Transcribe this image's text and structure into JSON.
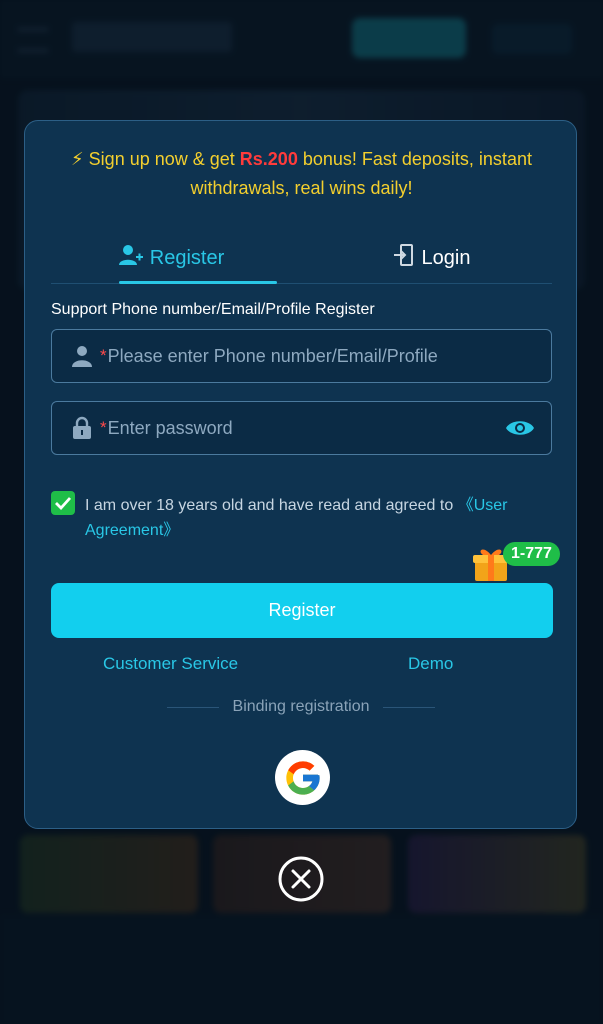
{
  "promo": {
    "bolt": "⚡",
    "prefix": " Sign up now & get ",
    "amount": "Rs.200",
    "suffix": " bonus! Fast deposits, instant withdrawals, real wins daily!"
  },
  "tabs": {
    "register": "Register",
    "login": "Login"
  },
  "support_label": "Support Phone number/Email/Profile Register",
  "fields": {
    "account": {
      "required_mark": "*",
      "placeholder": "Please enter Phone number/Email/Profile",
      "value": ""
    },
    "password": {
      "required_mark": "*",
      "placeholder": "Enter password",
      "value": ""
    }
  },
  "agreement": {
    "checked": true,
    "text": "I am over 18 years old and have read and agreed to ",
    "link": "《User Agreement》"
  },
  "gift_badge": "1-777",
  "register_button": "Register",
  "links": {
    "customer_service": "Customer Service",
    "demo": "Demo"
  },
  "binding_label": "Binding registration",
  "icons": [
    "user-plus-icon",
    "login-icon",
    "user-icon",
    "lock-icon",
    "eye-icon",
    "check-icon",
    "gift-icon",
    "google-icon",
    "close-icon"
  ],
  "colors": {
    "accent": "#29c7e6",
    "button": "#12cfee",
    "promo_text": "#f3cf2e",
    "promo_amount": "#ff3b3b",
    "check": "#1fbe48",
    "modal_bg": "#0e3350"
  }
}
